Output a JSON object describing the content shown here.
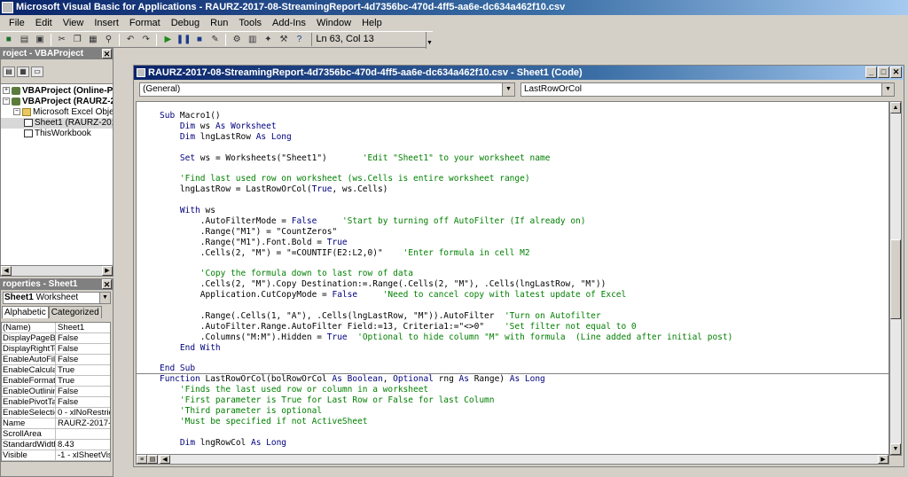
{
  "window": {
    "title": "Microsoft Visual Basic for Applications - RAURZ-2017-08-StreamingReport-4d7356bc-470d-4ff5-aa6e-dc634a462f10.csv"
  },
  "menu": [
    "File",
    "Edit",
    "View",
    "Insert",
    "Format",
    "Debug",
    "Run",
    "Tools",
    "Add-Ins",
    "Window",
    "Help"
  ],
  "toolbar": {
    "position": "Ln 63, Col 13"
  },
  "project": {
    "title": "roject - VBAProject",
    "items": [
      {
        "label": "VBAProject (Online-Pass",
        "level": 0,
        "expander": "+"
      },
      {
        "label": "VBAProject (RAURZ-201",
        "level": 0,
        "expander": "−"
      },
      {
        "label": "Microsoft Excel Objects",
        "level": 1,
        "expander": "−"
      },
      {
        "label": "Sheet1 (RAURZ-2017",
        "level": 2
      },
      {
        "label": "ThisWorkbook",
        "level": 2
      }
    ]
  },
  "properties": {
    "title": "roperties - Sheet1",
    "object_name": "Sheet1",
    "object_type": "Worksheet",
    "tabs": [
      "Alphabetic",
      "Categorized"
    ],
    "rows": [
      {
        "k": "(Name)",
        "v": "Sheet1"
      },
      {
        "k": "DisplayPageBreak",
        "v": "False"
      },
      {
        "k": "DisplayRightToLef",
        "v": "False"
      },
      {
        "k": "EnableAutoFilter",
        "v": "False"
      },
      {
        "k": "EnableCalculation",
        "v": "True"
      },
      {
        "k": "EnableFormatCon",
        "v": "True"
      },
      {
        "k": "EnableOutlining",
        "v": "False"
      },
      {
        "k": "EnablePivotTable",
        "v": "False"
      },
      {
        "k": "EnableSelection",
        "v": "0 - xlNoRestricti"
      },
      {
        "k": "Name",
        "v": "RAURZ-2017-08"
      },
      {
        "k": "ScrollArea",
        "v": ""
      },
      {
        "k": "StandardWidth",
        "v": "8.43"
      },
      {
        "k": "Visible",
        "v": "-1 - xlSheetVisib"
      }
    ]
  },
  "code_window": {
    "title": "RAURZ-2017-08-StreamingReport-4d7356bc-470d-4ff5-aa6e-dc634a462f10.csv - Sheet1 (Code)",
    "object_combo": "(General)",
    "proc_combo": "LastRowOrCol",
    "lines": [
      [
        {
          "t": "Sub ",
          "c": "kw"
        },
        {
          "t": "Macro1()"
        }
      ],
      [
        {
          "t": "    "
        },
        {
          "t": "Dim ",
          "c": "kw"
        },
        {
          "t": "ws "
        },
        {
          "t": "As Worksheet",
          "c": "kw"
        }
      ],
      [
        {
          "t": "    "
        },
        {
          "t": "Dim ",
          "c": "kw"
        },
        {
          "t": "lngLastRow "
        },
        {
          "t": "As Long",
          "c": "kw"
        }
      ],
      [
        {
          "t": ""
        }
      ],
      [
        {
          "t": "    "
        },
        {
          "t": "Set ",
          "c": "kw"
        },
        {
          "t": "ws = Worksheets(\"Sheet1\")       "
        },
        {
          "t": "'Edit \"Sheet1\" to your worksheet name",
          "c": "cm"
        }
      ],
      [
        {
          "t": ""
        }
      ],
      [
        {
          "t": "    "
        },
        {
          "t": "'Find last used row on worksheet (ws.Cells is entire worksheet range)",
          "c": "cm"
        }
      ],
      [
        {
          "t": "    lngLastRow = LastRowOrCol("
        },
        {
          "t": "True",
          "c": "kw"
        },
        {
          "t": ", ws.Cells)"
        }
      ],
      [
        {
          "t": ""
        }
      ],
      [
        {
          "t": "    "
        },
        {
          "t": "With ",
          "c": "kw"
        },
        {
          "t": "ws"
        }
      ],
      [
        {
          "t": "        .AutoFilterMode = "
        },
        {
          "t": "False",
          "c": "kw"
        },
        {
          "t": "     "
        },
        {
          "t": "'Start by turning off AutoFilter (If already on)",
          "c": "cm"
        }
      ],
      [
        {
          "t": "        .Range(\"M1\") = \"CountZeros\""
        }
      ],
      [
        {
          "t": "        .Range(\"M1\").Font.Bold = "
        },
        {
          "t": "True",
          "c": "kw"
        }
      ],
      [
        {
          "t": "        .Cells(2, \"M\") = \"=COUNTIF(E2:L2,0)\"    "
        },
        {
          "t": "'Enter formula in cell M2",
          "c": "cm"
        }
      ],
      [
        {
          "t": ""
        }
      ],
      [
        {
          "t": "        "
        },
        {
          "t": "'Copy the formula down to last row of data",
          "c": "cm"
        }
      ],
      [
        {
          "t": "        .Cells(2, \"M\").Copy Destination:=.Range(.Cells(2, \"M\"), .Cells(lngLastRow, \"M\"))"
        }
      ],
      [
        {
          "t": "        Application.CutCopyMode = "
        },
        {
          "t": "False",
          "c": "kw"
        },
        {
          "t": "     "
        },
        {
          "t": "'Need to cancel copy with latest update of Excel",
          "c": "cm"
        }
      ],
      [
        {
          "t": ""
        }
      ],
      [
        {
          "t": "        .Range(.Cells(1, \"A\"), .Cells(lngLastRow, \"M\")).AutoFilter  "
        },
        {
          "t": "'Turn on Autofilter",
          "c": "cm"
        }
      ],
      [
        {
          "t": "        .AutoFilter.Range.AutoFilter Field:=13, Criteria1:=\"<>0\"    "
        },
        {
          "t": "'Set filter not equal to 0",
          "c": "cm"
        }
      ],
      [
        {
          "t": "        .Columns(\"M:M\").Hidden = "
        },
        {
          "t": "True",
          "c": "kw"
        },
        {
          "t": "  "
        },
        {
          "t": "'Optional to hide column \"M\" with formula  (Line added after initial post)",
          "c": "cm"
        }
      ],
      [
        {
          "t": "    "
        },
        {
          "t": "End With",
          "c": "kw"
        }
      ],
      [
        {
          "t": ""
        }
      ],
      [
        {
          "t": "End Sub",
          "c": "kw"
        }
      ],
      [
        {
          "t": "Function ",
          "c": "kw"
        },
        {
          "t": "LastRowOrCol(bolRowOrCol "
        },
        {
          "t": "As Boolean",
          "c": "kw"
        },
        {
          "t": ", "
        },
        {
          "t": "Optional ",
          "c": "kw"
        },
        {
          "t": "rng "
        },
        {
          "t": "As ",
          "c": "kw"
        },
        {
          "t": "Range) "
        },
        {
          "t": "As Long",
          "c": "kw"
        }
      ],
      [
        {
          "t": "    "
        },
        {
          "t": "'Finds the last used row or column in a worksheet",
          "c": "cm"
        }
      ],
      [
        {
          "t": "    "
        },
        {
          "t": "'First parameter is True for Last Row or False for last Column",
          "c": "cm"
        }
      ],
      [
        {
          "t": "    "
        },
        {
          "t": "'Third parameter is optional",
          "c": "cm"
        }
      ],
      [
        {
          "t": "    "
        },
        {
          "t": "'Must be specified if not ActiveSheet",
          "c": "cm"
        }
      ],
      [
        {
          "t": ""
        }
      ],
      [
        {
          "t": "    "
        },
        {
          "t": "Dim ",
          "c": "kw"
        },
        {
          "t": "lngRowCol "
        },
        {
          "t": "As Long",
          "c": "kw"
        }
      ]
    ]
  }
}
